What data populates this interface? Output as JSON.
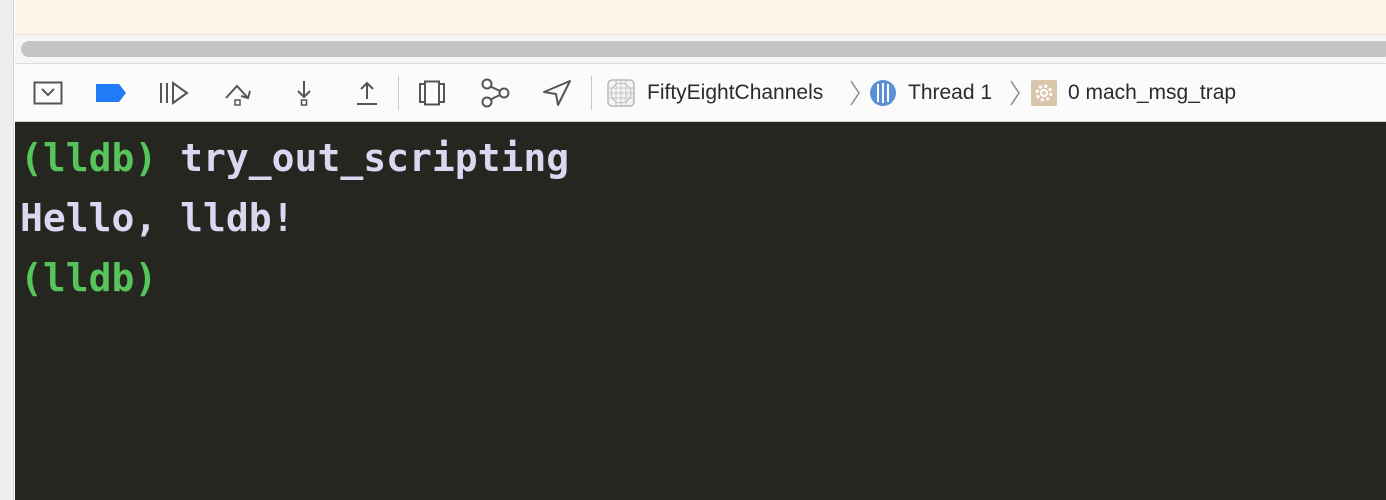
{
  "toolbar": {
    "buttons": [
      {
        "icon": "hide-debug-area-icon"
      },
      {
        "icon": "breakpoints-toggle-icon",
        "color": "#1f7cf6"
      },
      {
        "icon": "continue-icon"
      },
      {
        "icon": "step-over-icon"
      },
      {
        "icon": "step-into-icon"
      },
      {
        "icon": "step-out-icon"
      },
      {
        "icon": "view-hierarchy-icon"
      },
      {
        "icon": "memory-graph-icon"
      },
      {
        "icon": "simulate-location-icon"
      }
    ]
  },
  "breadcrumb": {
    "process": "FiftyEightChannels",
    "thread": "Thread 1",
    "frame": "0 mach_msg_trap",
    "thread_icon_color": "#5b8fd6"
  },
  "console": {
    "prompt": "(lldb)",
    "lines": [
      {
        "prompt": "(lldb)",
        "command": "try_out_scripting"
      },
      {
        "output": "Hello, lldb!"
      },
      {
        "prompt": "(lldb)",
        "command": ""
      }
    ],
    "prompt_color": "#56c45a",
    "text_color": "#dcd6f0",
    "background": "#262621"
  }
}
